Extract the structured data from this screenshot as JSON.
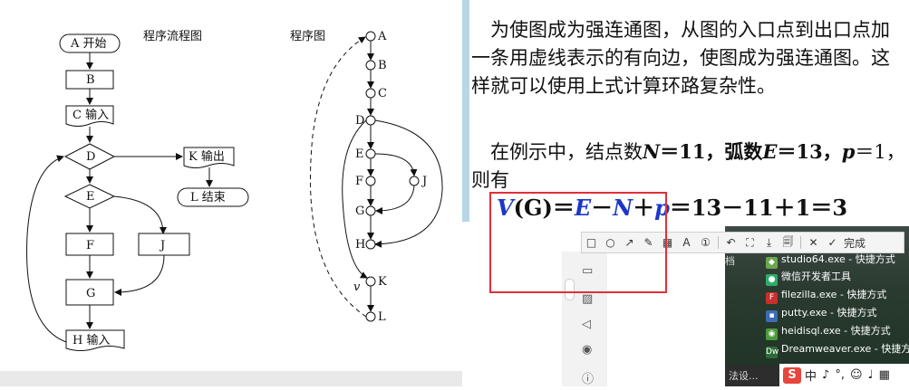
{
  "flowchart": {
    "title_program_flow": "程序流程图",
    "title_program_graph": "程序图",
    "nodes": {
      "a": "A 开始",
      "b": "B",
      "c": "C 输入",
      "d": "D",
      "k": "K 输出",
      "e": "E",
      "l": "L 结束",
      "f": "F",
      "j": "J",
      "g": "G",
      "h": "H 输入"
    },
    "graph_nodes": [
      "A",
      "B",
      "C",
      "D",
      "E",
      "F",
      "J",
      "G",
      "H",
      "K",
      "L"
    ],
    "edge_label_v": "v"
  },
  "slide": {
    "para1": "为使图成为强连通图，从图的入口点到出口点加一条用虚线表示的有向边，使图成为强连通图。这样就可以使用上式计算环路复杂性。",
    "para2_prefix": "在例示中，结点数",
    "n_symbol": "N",
    "n_eq": "＝11，弧数",
    "e_symbol": "E",
    "e_eq": "＝13，",
    "p_symbol": "p",
    "p_eq": "＝1，则有",
    "formula": {
      "vg": "V",
      "g": "(G)",
      "eq1": "＝",
      "e": "E",
      "minus": "－",
      "n": "N",
      "plus": "＋",
      "p": "p",
      "rest": "＝13－11＋1＝3"
    }
  },
  "toolbar": {
    "items": [
      "□",
      "○",
      "↗",
      "✎",
      "▦",
      "A",
      "①",
      "↶",
      "⛶",
      "⤓",
      "🗐",
      "✕",
      "✓"
    ],
    "done_label": "完成"
  },
  "desktop": {
    "items": [
      {
        "icon": "studio-icon",
        "label": "studio64.exe - 快捷方式",
        "color": "#6aa84f"
      },
      {
        "icon": "wechat-dev-icon",
        "label": "微信开发者工具",
        "color": "#2aae67"
      },
      {
        "icon": "filezilla-icon",
        "label": "filezilla.exe - 快捷方式",
        "color": "#c9302c"
      },
      {
        "icon": "putty-icon",
        "label": "putty.exe - 快捷方式",
        "color": "#3b6db3"
      },
      {
        "icon": "heidisql-icon",
        "label": "heidisql.exe - 快捷方式",
        "color": "#4a9b3a"
      },
      {
        "icon": "dreamweaver-icon",
        "label": "Dreamweaver.exe - 快捷方",
        "color": "#2f6b3a"
      }
    ],
    "edge_text_top": "档",
    "edge_text_bottom": "法设..."
  },
  "ime": {
    "logo": "S",
    "glyphs": [
      "中",
      "♪",
      "°,",
      "☺",
      "♩",
      "▦"
    ]
  }
}
